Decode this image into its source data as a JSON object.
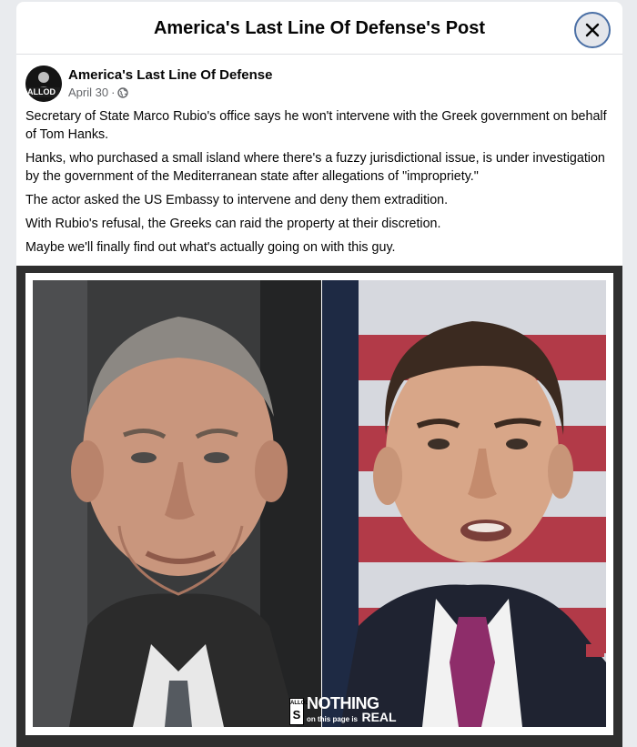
{
  "header": {
    "title": "America's Last Line Of Defense's Post"
  },
  "post": {
    "author": "America's Last Line Of Defense",
    "avatar_text": "ALLOD",
    "date": "April 30",
    "separator": "·",
    "privacy_icon": "globe-icon",
    "paragraphs": [
      "Secretary of State Marco Rubio's office says he won't intervene with the Greek government on behalf of Tom Hanks.",
      "Hanks, who purchased a small island where there's a fuzzy jurisdictional issue, is under investigation by the government of the Mediterranean state after allegations of \"impropriety.\"",
      "The actor asked the US Embassy to intervene and deny them extradition.",
      "With Rubio's refusal, the Greeks can raid the property at their discretion.",
      "Maybe we'll finally find out what's actually going on with this guy."
    ]
  },
  "image": {
    "watermark_box": "ALLOD",
    "watermark_box_letter": "S",
    "watermark_top": "NOTHING",
    "watermark_bottom_small": "on this page is",
    "watermark_bottom_big": "REAL"
  },
  "colors": {
    "accent": "#4a6fa5",
    "text": "#050505",
    "meta": "#65676b",
    "tie": "#8e2d6a"
  }
}
